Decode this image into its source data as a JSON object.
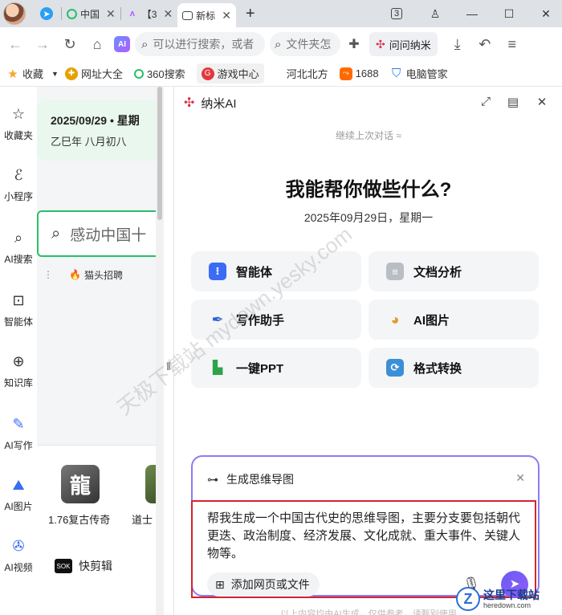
{
  "tabs": [
    {
      "label": "",
      "icon": "telegram-icon"
    },
    {
      "label": "中国",
      "icon": "360-search-icon"
    },
    {
      "label": "【3",
      "icon": "ai-gradient-icon"
    },
    {
      "label": "新标",
      "icon": "new-tab-page-icon"
    }
  ],
  "window_controls": {
    "tab_count": "3"
  },
  "toolbar": {
    "address_placeholder": "可以进行搜索，或者",
    "search_placeholder": "文件夹怎",
    "nami_button": "问问纳米",
    "ai_badge": "AI"
  },
  "bookmarks": [
    {
      "label": "收藏"
    },
    {
      "label": "网址大全"
    },
    {
      "label": "360搜索"
    },
    {
      "label": "游戏中心"
    },
    {
      "label": "河北北方"
    },
    {
      "label": "1688"
    },
    {
      "label": "电脑管家"
    }
  ],
  "rail": [
    {
      "label": "收藏夹"
    },
    {
      "label": "小程序"
    },
    {
      "label": "AI搜索"
    },
    {
      "label": "智能体"
    },
    {
      "label": "知识库"
    },
    {
      "label": "AI写作"
    },
    {
      "label": "AI图片"
    },
    {
      "label": "AI视频"
    }
  ],
  "ntp": {
    "date_line": "2025/09/29 • 星期",
    "lunar_line": "乙巳年 八月初八",
    "search_text": "感动中国十",
    "quick_link": "猫头招聘",
    "games": [
      {
        "icon_text": "龍",
        "label": "1.76复古传奇"
      },
      {
        "label": "道士"
      }
    ],
    "kuaijian": "快剪辑",
    "kuaijian_icon": "SOK"
  },
  "panel": {
    "title": "纳米AI",
    "continue_label": "继续上次对话 ≈",
    "headline": "我能帮你做些什么?",
    "date": "2025年09月29日，星期一",
    "cards": [
      {
        "label": "智能体",
        "icon": "agent-icon",
        "color": "#3b6cf6"
      },
      {
        "label": "文档分析",
        "icon": "document-icon",
        "color": "#9aa0a6"
      },
      {
        "label": "写作助手",
        "icon": "pen-icon",
        "color": "#2d5fd3"
      },
      {
        "label": "AI图片",
        "icon": "palette-icon",
        "color": "#e59a2f"
      },
      {
        "label": "一键PPT",
        "icon": "chart-icon",
        "color": "#2fa34a"
      },
      {
        "label": "格式转换",
        "icon": "convert-icon",
        "color": "#3c8fd6"
      }
    ],
    "mindmap_label": "生成思维导图",
    "prompt_text": "帮我生成一个中国古代史的思维导图，主要分支要包括朝代更迭、政治制度、经济发展、文化成就、重大事件、关键人物等。",
    "attach_label": "添加网页或文件",
    "footnote": "以上内容均由AI生成，仅供参考，请甄别使用"
  },
  "watermark": {
    "diagonal": "天极下载站 mydown.yesky.com",
    "corner_title": "这里下载站",
    "corner_sub": "heredown.com"
  }
}
